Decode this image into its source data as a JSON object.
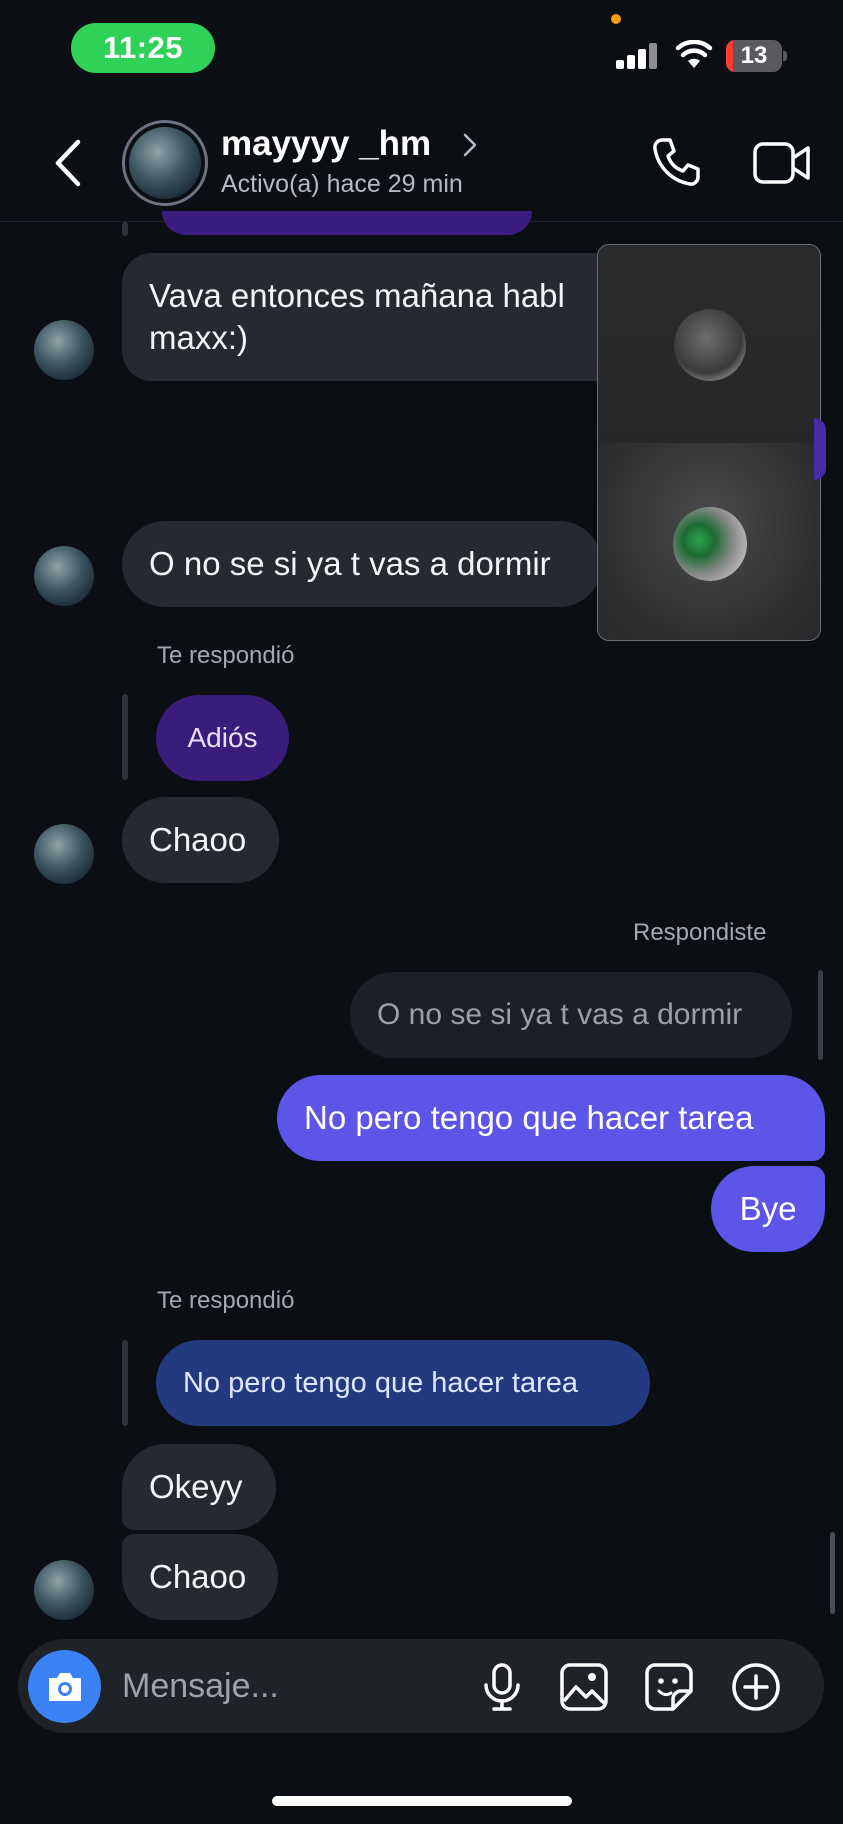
{
  "status_bar": {
    "time": "11:25",
    "battery": "13",
    "battery_level": 0.13
  },
  "header": {
    "contact_name": "mayyyy _hm",
    "contact_status": "Activo(a) hace 29 min"
  },
  "messages": {
    "m1_line1": "Vava entonces mañana habl",
    "m1_line2": "maxx:)",
    "m2": "O no se si ya t vas a dormir",
    "reply1_label": "Te respondió",
    "reply1_quote": "Adiós",
    "m3": "Chaoo",
    "reply2_label": "Respondiste",
    "reply2_quote": "O no se si ya t vas a dormir",
    "out1": "No pero tengo que hacer tarea",
    "out2": "Bye",
    "reply3_label": "Te respondió",
    "reply3_quote": "No pero tengo que hacer tarea",
    "m4": "Okeyy",
    "m5": "Chaoo"
  },
  "composer": {
    "placeholder": "Mensaje..."
  },
  "colors": {
    "background": "#0b0e13",
    "incoming_bubble": "#26292f",
    "outgoing_bubble": "#5b55e8",
    "camera_button": "#3b82f6",
    "time_pill": "#30d158"
  },
  "icons": [
    "back-icon",
    "phone-icon",
    "video-camera-icon",
    "camera-icon",
    "microphone-icon",
    "image-icon",
    "sticker-icon",
    "plus-circle-icon"
  ]
}
